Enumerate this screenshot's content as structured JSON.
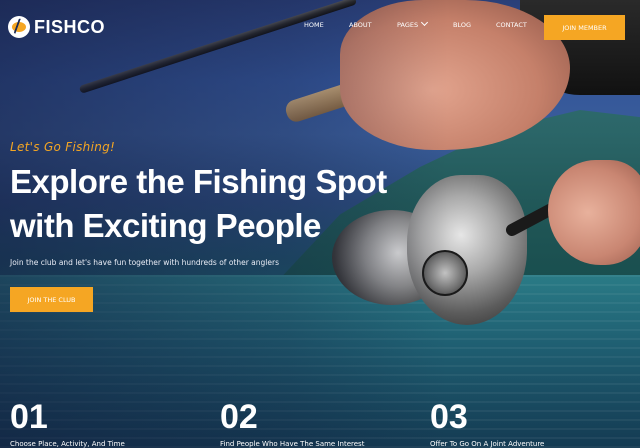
{
  "brand": {
    "name": "FISHCO"
  },
  "nav": {
    "items": [
      {
        "label": "HOME"
      },
      {
        "label": "ABOUT"
      },
      {
        "label": "PAGES"
      },
      {
        "label": "BLOG"
      },
      {
        "label": "CONTACT"
      }
    ],
    "cta_label": "JOIN MEMBER"
  },
  "hero": {
    "eyebrow": "Let's Go Fishing!",
    "headline_line1": "Explore the Fishing Spot",
    "headline_line2": "with Exciting People",
    "subtitle": "Join the club and let's have fun together with hundreds of other anglers",
    "button_label": "JOIN THE CLUB"
  },
  "features": [
    {
      "number": "01",
      "title": "Choose Place, Activity, And Time"
    },
    {
      "number": "02",
      "title": "Find People Who Have The Same Interest"
    },
    {
      "number": "03",
      "title": "Offer To Go On A Joint Adventure"
    }
  ],
  "colors": {
    "accent": "#f5a623",
    "text": "#ffffff"
  },
  "icons": {
    "logo": "fish-logo-icon",
    "dropdown": "chevron-down-icon"
  }
}
